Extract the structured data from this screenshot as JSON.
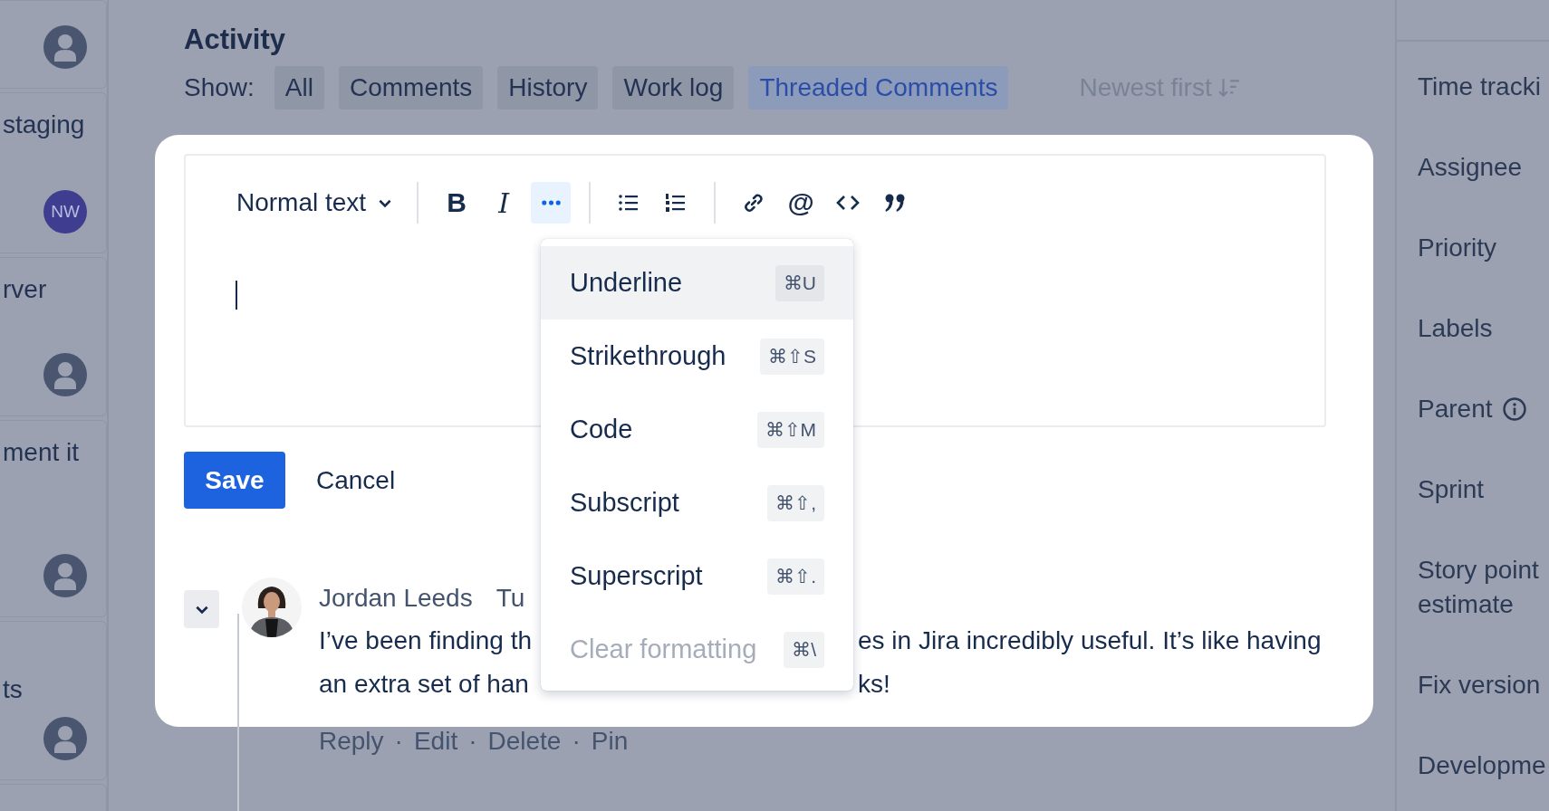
{
  "left_cards": [
    {
      "kind": "silhouette"
    },
    {
      "text": "staging",
      "kind": "initials",
      "initials": "NW"
    },
    {
      "text": "rver",
      "kind": "silhouette"
    },
    {
      "text": "ment it",
      "kind": "silhouette"
    },
    {
      "text": "ts",
      "kind": "silhouette"
    }
  ],
  "activity": {
    "title": "Activity",
    "show_label": "Show:",
    "sort": "Newest first",
    "filters": [
      {
        "label": "All",
        "selected": false
      },
      {
        "label": "Comments",
        "selected": false
      },
      {
        "label": "History",
        "selected": false
      },
      {
        "label": "Work log",
        "selected": false
      },
      {
        "label": "Threaded Comments",
        "selected": true
      }
    ]
  },
  "editor": {
    "text_style": "Normal text",
    "toolbar_groups": [
      [
        {
          "kind": "bold",
          "label": "B",
          "selected": false
        },
        {
          "kind": "italic",
          "label": "I",
          "selected": false
        },
        {
          "kind": "more",
          "selected": true
        }
      ],
      [
        {
          "kind": "bullet-list",
          "selected": false
        },
        {
          "kind": "numbered-list",
          "selected": false
        }
      ],
      [
        {
          "kind": "link",
          "selected": false
        },
        {
          "kind": "mention",
          "label": "@",
          "selected": false
        },
        {
          "kind": "code",
          "selected": false
        },
        {
          "kind": "quote",
          "selected": false
        }
      ]
    ],
    "menu": [
      {
        "label": "Underline",
        "shortcut": "⌘U",
        "selected": true,
        "disabled": false
      },
      {
        "label": "Strikethrough",
        "shortcut": "⌘⇧S",
        "selected": false,
        "disabled": false
      },
      {
        "label": "Code",
        "shortcut": "⌘⇧M",
        "selected": false,
        "disabled": false
      },
      {
        "label": "Subscript",
        "shortcut": "⌘⇧,",
        "selected": false,
        "disabled": false
      },
      {
        "label": "Superscript",
        "shortcut": "⌘⇧.",
        "selected": false,
        "disabled": false
      },
      {
        "label": "Clear formatting",
        "shortcut": "⌘\\",
        "selected": false,
        "disabled": true
      }
    ],
    "save": "Save",
    "cancel": "Cancel"
  },
  "comment": {
    "expanded": true,
    "author": "Jordan Leeds",
    "time": "Tu",
    "lines": [
      {
        "before": "I’ve been finding th",
        "after": "es in Jira incredibly useful. It’s like having"
      },
      {
        "before": "an extra set of han",
        "after": "ks!"
      }
    ],
    "actions": [
      "Reply",
      "Edit",
      "Delete",
      "Pin"
    ],
    "separator": "·"
  },
  "details": [
    {
      "label": "Time tracki",
      "info": false
    },
    {
      "label": "Assignee",
      "info": false
    },
    {
      "label": "Priority",
      "info": false
    },
    {
      "label": "Labels",
      "info": false
    },
    {
      "label": "Parent",
      "info": true
    },
    {
      "label": "Sprint",
      "info": false
    },
    {
      "label": "Story point estimate",
      "info": false
    },
    {
      "label": "Fix version",
      "info": false
    },
    {
      "label": "Developme",
      "info": false
    }
  ]
}
